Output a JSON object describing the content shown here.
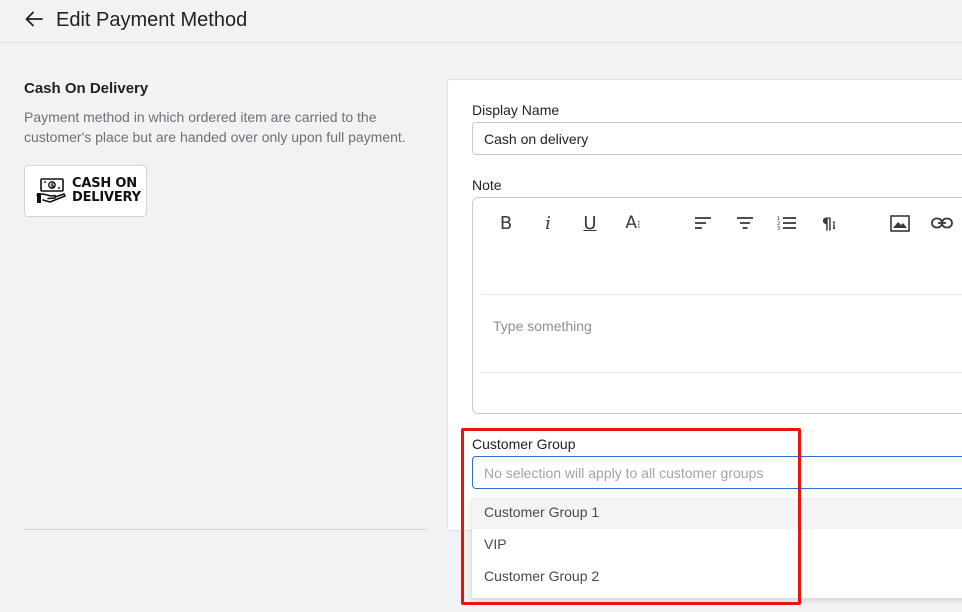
{
  "header": {
    "title": "Edit Payment Method",
    "back_icon": "arrow-left-icon"
  },
  "method": {
    "name": "Cash On Delivery",
    "description": "Payment method in which ordered item are carried to the customer's place but are handed over only upon full payment.",
    "logo_line1": "CASH ON",
    "logo_line2": "DELIVERY"
  },
  "form": {
    "display_name_label": "Display Name",
    "display_name_value": "Cash on delivery",
    "note_label": "Note",
    "note_placeholder": "Type something",
    "customer_group_label": "Customer Group",
    "customer_group_placeholder": "No selection will apply to all customer groups"
  },
  "toolbar": {
    "bold": "B",
    "italic": "i",
    "underline": "U",
    "font": "A",
    "icons": [
      "bold-icon",
      "italic-icon",
      "underline-icon",
      "font-size-icon",
      "align-left-icon",
      "align-center-icon",
      "ordered-list-icon",
      "paragraph-icon",
      "image-icon",
      "link-icon"
    ]
  },
  "dropdown": {
    "options": [
      "Customer Group 1",
      "VIP",
      "Customer Group 2"
    ],
    "hovered_index": 0
  },
  "colors": {
    "accent": "#2c6ecb",
    "highlight": "#e81313"
  }
}
